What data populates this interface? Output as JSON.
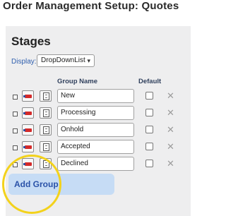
{
  "page": {
    "title": "Order Management Setup: Quotes"
  },
  "stages": {
    "heading": "Stages",
    "display_label": "Display:",
    "display_value": "DropDownList",
    "columns": {
      "group_name": "Group Name",
      "default": "Default"
    },
    "rows": [
      {
        "name": "New",
        "default": false
      },
      {
        "name": "Processing",
        "default": false
      },
      {
        "name": "Onhold",
        "default": false
      },
      {
        "name": "Accepted",
        "default": false
      },
      {
        "name": "Declined",
        "default": false
      }
    ],
    "remove_glyph": "✕",
    "add_group_label": "Add Group"
  },
  "icons": {
    "drag": "drag-handle-icon",
    "delete": "delete-row-icon",
    "copy": "copy-row-icon",
    "remove": "close-icon",
    "chevron": "chevron-down-icon"
  },
  "colors": {
    "panel_bg": "#eeeeef",
    "accent_blue": "#2a52a8",
    "button_bg": "#c6dcf5",
    "highlight": "#f3d21c",
    "delete_red": "#d42a2a"
  }
}
